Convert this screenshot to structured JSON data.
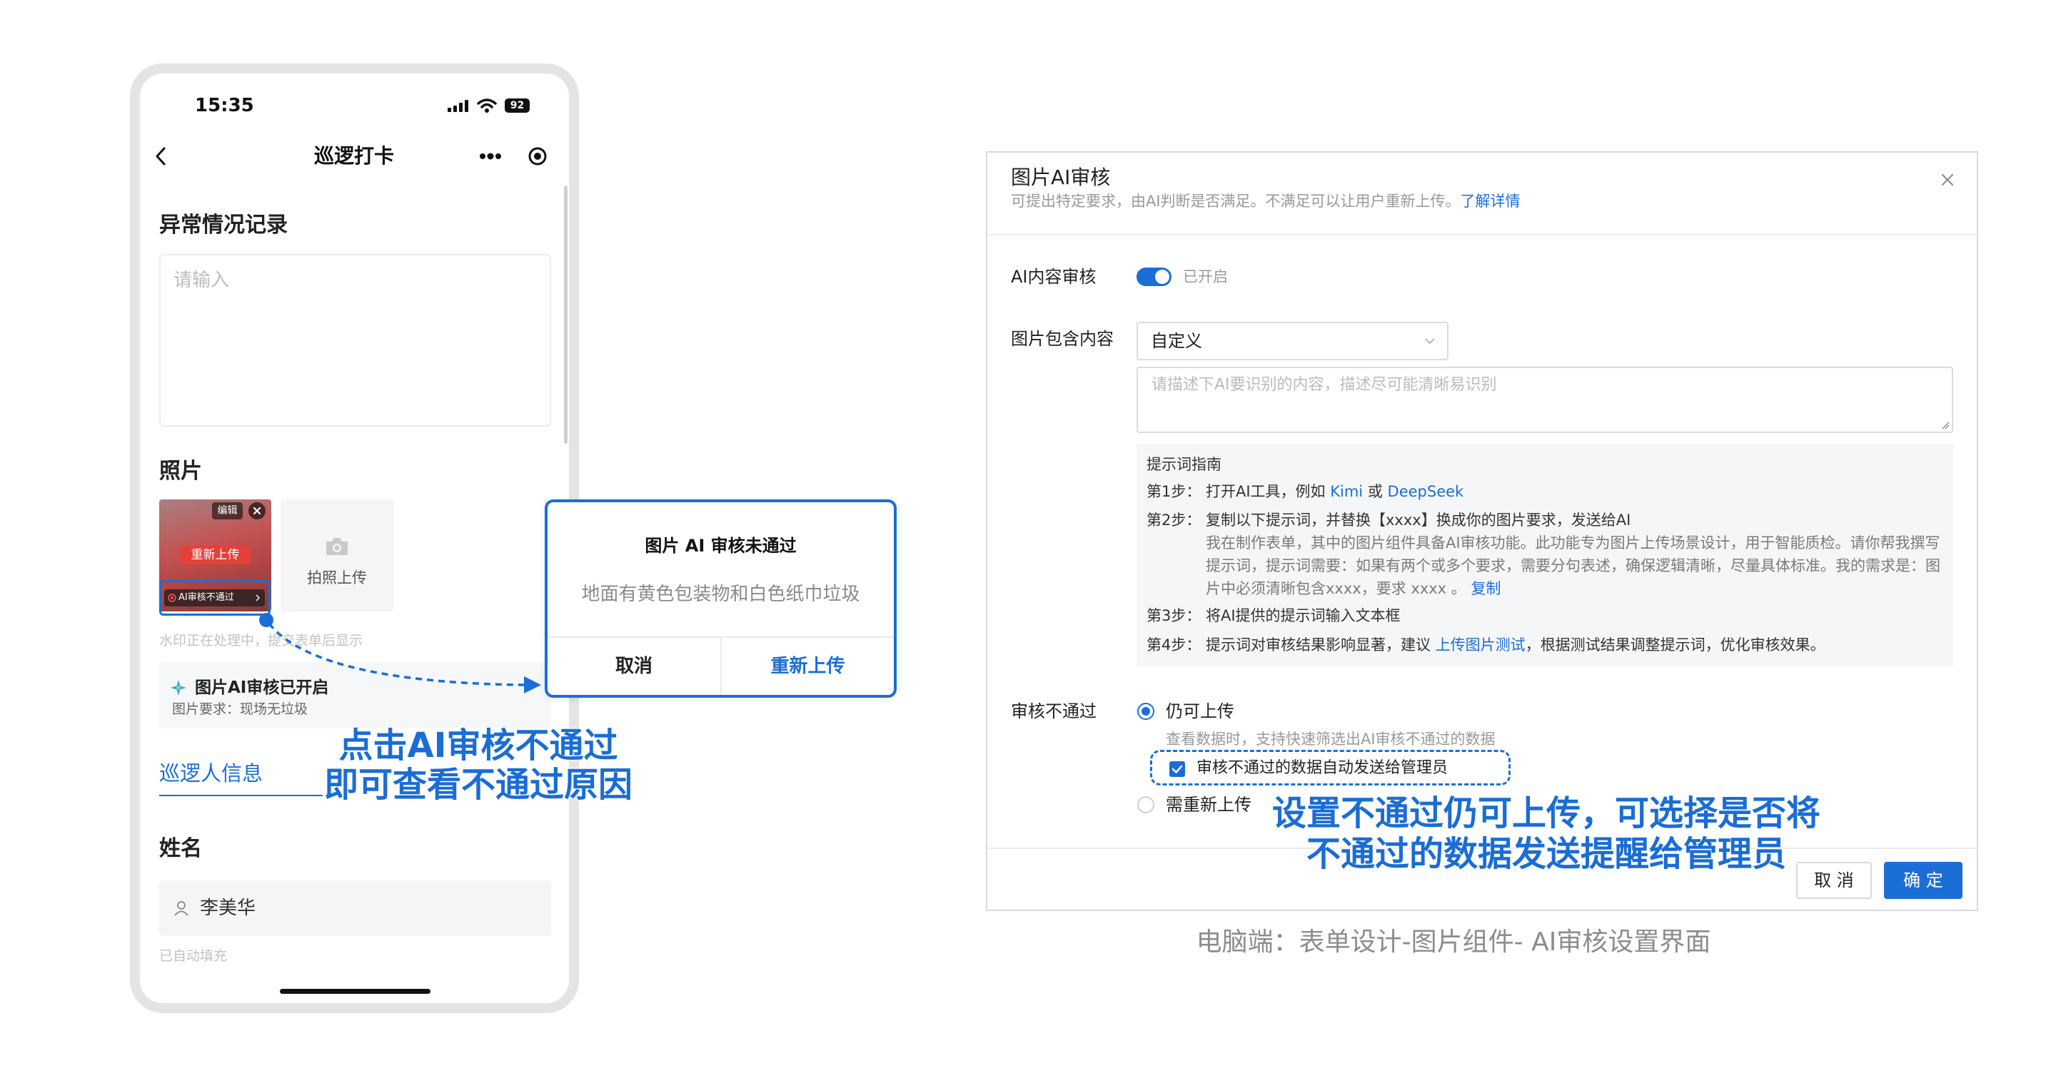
{
  "colors": {
    "accent": "#1b6ed6",
    "annotation": "#1a6dd4",
    "danger": "#e5403a",
    "muted": "#999999"
  },
  "icons": {
    "back": "chevron-left-icon",
    "more": "more-dots-icon",
    "record": "record-target-icon",
    "signal": "signal-icon",
    "wifi": "wifi-icon",
    "battery": "battery-icon",
    "thumb_close": "close-circle-icon",
    "ai_fail": "error-circle-icon",
    "camera": "camera-icon",
    "ai": "ai-sparkle-icon",
    "person": "person-icon",
    "dialog_close": "close-icon",
    "select": "chevron-down-icon",
    "check": "checkmark-icon"
  },
  "phone": {
    "status": {
      "time": "15:35",
      "battery": "92"
    },
    "nav": {
      "title": "巡逻打卡"
    },
    "abnormal": {
      "label": "异常情况记录",
      "placeholder": "请输入"
    },
    "photo": {
      "label": "照片",
      "edit_tag": "编辑",
      "reupload": "重新上传",
      "ai_fail": "AI审核不通过",
      "camera_upload": "拍照上传",
      "watermark_note": "水印正在处理中，提交表单后显示"
    },
    "ai_card": {
      "title": "图片AI审核已开启",
      "requirement": "图片要求：现场无垃圾"
    },
    "patrol_section": "巡逻人信息",
    "name": {
      "label": "姓名",
      "value": "李美华",
      "note": "已自动填充"
    }
  },
  "popup": {
    "title": "图片 AI 审核未通过",
    "reason": "地面有黄色包装物和白色纸巾垃圾",
    "cancel": "取消",
    "reupload": "重新上传"
  },
  "annotations": {
    "left": [
      "点击AI审核不通过",
      "即可查看不通过原因"
    ],
    "right": [
      "设置不通过仍可上传，可选择是否将",
      "不通过的数据发送提醒给管理员"
    ]
  },
  "dialog": {
    "title": "图片AI审核",
    "subtitle": "可提出特定要求，由AI判断是否满足。不满足可以让用户重新上传。",
    "learn_more": "了解详情",
    "ai_review": {
      "label": "AI内容审核",
      "enabled": true,
      "state_text": "已开启"
    },
    "content": {
      "label": "图片包含内容",
      "selected": "自定义",
      "placeholder": "请描述下AI要识别的内容，描述尽可能清晰易识别"
    },
    "guide": {
      "title": "提示词指南",
      "step1": {
        "label": "第1步：",
        "text": "打开AI工具，例如",
        "link_kimi": "Kimi",
        "or": "或",
        "link_deepseek": "DeepSeek"
      },
      "step2": {
        "label": "第2步：",
        "text": "复制以下提示词，并替换【xxxx】换成你的图片要求，发送给AI",
        "prompt": "我在制作表单，其中的图片组件具备AI审核功能。此功能专为图片上传场景设计，用于智能质检。请你帮我撰写提示词，提示词需要：如果有两个或多个要求，需要分句表述，确保逻辑清晰，尽量具体标准。我的需求是：图片中必须清晰包含xxxx，要求 xxxx 。",
        "copy_link": "复制"
      },
      "step3": {
        "label": "第3步：",
        "text": "将AI提供的提示词输入文本框"
      },
      "step4": {
        "label": "第4步：",
        "text_before": "提示词对审核结果影响显著，建议",
        "link": "上传图片测试",
        "text_after": "，根据测试结果调整提示词，优化审核效果。"
      }
    },
    "reject": {
      "label": "审核不通过",
      "option_allow": {
        "label": "仍可上传",
        "selected": true,
        "note": "查看数据时，支持快速筛选出AI审核不通过的数据"
      },
      "notify_admin": {
        "label": "审核不通过的数据自动发送给管理员",
        "checked": true
      },
      "option_reupload": {
        "label": "需重新上传",
        "selected": false
      }
    },
    "footer": {
      "cancel": "取 消",
      "confirm": "确 定"
    }
  },
  "caption": "电脑端：表单设计-图片组件- AI审核设置界面"
}
